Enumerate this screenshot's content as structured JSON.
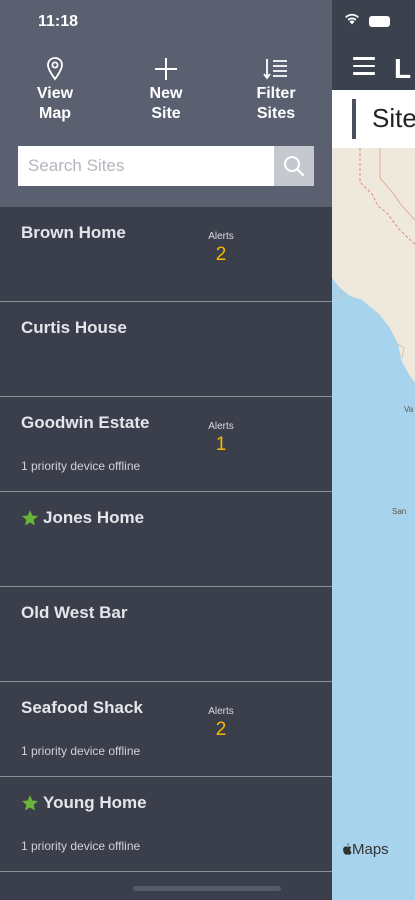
{
  "status_bar": {
    "time": "11:18"
  },
  "drawer": {
    "actions": [
      {
        "label": "View\nMap",
        "icon": "location-pin-icon"
      },
      {
        "label": "New\nSite",
        "icon": "plus-icon"
      },
      {
        "label": "Filter\nSites",
        "icon": "sort-filter-icon"
      }
    ],
    "search": {
      "placeholder": "Search Sites",
      "value": ""
    },
    "sites": [
      {
        "name": "Brown Home",
        "favorite": false,
        "alerts_label": "Alerts",
        "alerts_count": "2",
        "note": ""
      },
      {
        "name": "Curtis House",
        "favorite": false,
        "alerts_label": "",
        "alerts_count": "",
        "note": ""
      },
      {
        "name": "Goodwin Estate",
        "favorite": false,
        "alerts_label": "Alerts",
        "alerts_count": "1",
        "note": "1 priority device offline"
      },
      {
        "name": "Jones Home",
        "favorite": true,
        "alerts_label": "",
        "alerts_count": "",
        "note": ""
      },
      {
        "name": "Old West Bar",
        "favorite": false,
        "alerts_label": "",
        "alerts_count": "",
        "note": ""
      },
      {
        "name": "Seafood Shack",
        "favorite": false,
        "alerts_label": "Alerts",
        "alerts_count": "2",
        "note": "1 priority device offline"
      },
      {
        "name": "Young Home",
        "favorite": true,
        "alerts_label": "",
        "alerts_count": "",
        "note": "1 priority device offline"
      }
    ]
  },
  "main": {
    "logo_text": "L",
    "title": "Site",
    "map_labels": [
      "Va",
      "San"
    ],
    "maps_attribution": "Maps"
  },
  "colors": {
    "drawer_header": "#5b6070",
    "drawer_list": "#3b3f4c",
    "divider": "#8b8f9a",
    "alert_count": "#f5b800",
    "favorite_star": "#6ab43b",
    "ocean": "#a7d4ec",
    "land": "#efe9dd"
  }
}
